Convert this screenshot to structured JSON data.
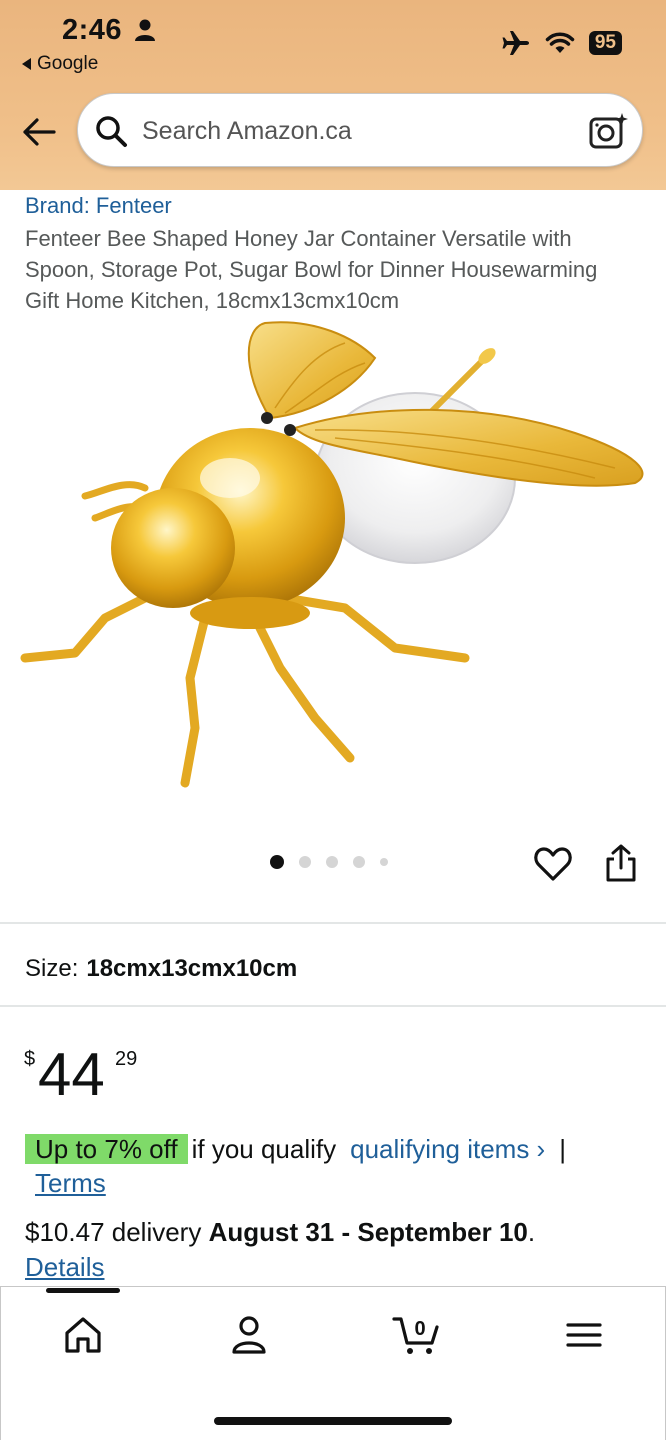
{
  "status_bar": {
    "time": "2:46",
    "back_app": "Google",
    "battery": "95"
  },
  "search": {
    "placeholder": "Search Amazon.ca"
  },
  "product": {
    "brand": "Brand: Fenteer",
    "title": "Fenteer Bee Shaped Honey Jar Container Versatile with Spoon, Storage Pot, Sugar Bowl for Dinner Housewarming Gift Home Kitchen, 18cmx13cmx10cm",
    "image_count": 5,
    "active_image": 1
  },
  "size": {
    "label": "Size:",
    "value": "18cmx13cmx10cm"
  },
  "price": {
    "symbol": "$",
    "whole": "44",
    "cents": "29"
  },
  "promo": {
    "badge": "Up to 7% off",
    "text": "if you qualify",
    "link": "qualifying items ›",
    "separator": "|",
    "terms": "Terms"
  },
  "delivery": {
    "prefix": "$10.47 delivery",
    "dates": "August 31 - September 10",
    "suffix": ".",
    "details": "Details"
  },
  "bottom_nav": {
    "cart_count": "0",
    "items": [
      "home-icon",
      "account-icon",
      "cart-icon",
      "menu-icon"
    ]
  },
  "colors": {
    "header": "#f0c08a",
    "link": "#1f5f99",
    "promo_badge": "#7fda69"
  }
}
